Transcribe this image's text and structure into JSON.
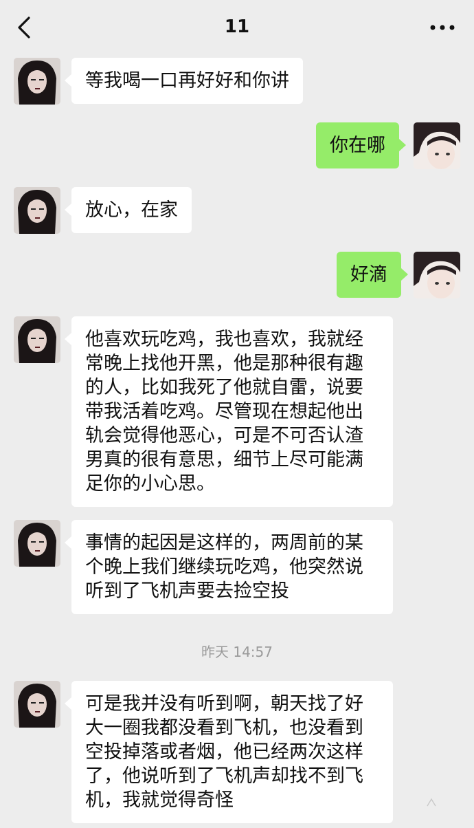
{
  "header": {
    "title": "11",
    "back_icon": "chevron-left-icon",
    "more_icon": "ellipsis-icon"
  },
  "colors": {
    "background": "#ededed",
    "incoming_bubble": "#ffffff",
    "outgoing_bubble": "#95ec69",
    "timestamp_text": "#9a9a9a"
  },
  "messages": [
    {
      "sender": "other",
      "text": "等我喝一口再好好和你讲"
    },
    {
      "sender": "me",
      "text": "你在哪"
    },
    {
      "sender": "other",
      "text": "放心，在家"
    },
    {
      "sender": "me",
      "text": "好滴"
    },
    {
      "sender": "other",
      "lines": [
        "他喜欢玩吃鸡，我也喜欢，我就经",
        "常晚上找他开黑，他是那种很有趣",
        "的人，比如我死了他就自雷，说要",
        "带我活着吃鸡。尽管现在想起他出",
        "轨会觉得他恶心，可是不可否认渣",
        "男真的很有意思，细节上尽可能满",
        "足你的小心思。"
      ]
    },
    {
      "sender": "other",
      "lines": [
        "事情的起因是这样的，两周前的某",
        "个晚上我们继续玩吃鸡，他突然说",
        "听到了飞机声要去捡空投"
      ]
    },
    {
      "sender": "other",
      "lines": [
        "可是我并没有听到啊，朝天找了好",
        "大一圈我都没看到飞机，也没看到",
        "空投掉落或者烟，他已经两次这样",
        "了，他说听到了飞机声却找不到飞",
        "机，我就觉得奇怪"
      ]
    }
  ],
  "timestamp": "昨天 14:57"
}
